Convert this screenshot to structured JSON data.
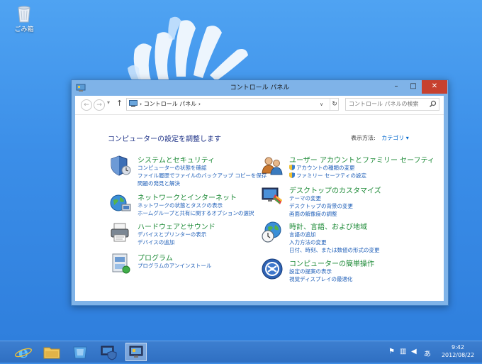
{
  "desktop": {
    "recycle_bin_label": "ごみ箱"
  },
  "window": {
    "title": "コントロール パネル",
    "buttons": {
      "minimize": "–",
      "maximize": "□",
      "close": "✕"
    },
    "nav": {
      "back": "←",
      "forward": "→",
      "recent": "▾",
      "up": "↑"
    },
    "address": {
      "path": "›  コントロール パネル  ›",
      "dropdown": "∨",
      "refresh": "↻"
    },
    "search": {
      "placeholder": "コントロール パネルの検索"
    },
    "heading": "コンピューターの設定を調整します",
    "view_by": {
      "label": "表示方法:",
      "value": "カテゴリ ▾"
    },
    "categories": [
      {
        "title": "システムとセキュリティ",
        "icon": "shield-icon",
        "links": [
          "コンピューターの状態を確認",
          "ファイル履歴でファイルのバックアップ コピーを保存",
          "問題の発見と解決"
        ]
      },
      {
        "title": "ネットワークとインターネット",
        "icon": "network-globe-icon",
        "links": [
          "ネットワークの状態とタスクの表示",
          "ホームグループと共有に関するオプションの選択"
        ]
      },
      {
        "title": "ハードウェアとサウンド",
        "icon": "printer-icon",
        "links": [
          "デバイスとプリンターの表示",
          "デバイスの追加"
        ]
      },
      {
        "title": "プログラム",
        "icon": "programs-icon",
        "links": [
          "プログラムのアンインストール"
        ]
      },
      {
        "title": "ユーザー アカウントとファミリー セーフティ",
        "icon": "users-icon",
        "links": [
          "アカウントの種類の変更",
          "ファミリー セーフティの設定"
        ]
      },
      {
        "title": "デスクトップのカスタマイズ",
        "icon": "monitor-paint-icon",
        "links": [
          "テーマの変更",
          "デスクトップの背景の変更",
          "画面の解像度の調整"
        ]
      },
      {
        "title": "時計、言語、および地域",
        "icon": "clock-globe-icon",
        "links": [
          "言語の追加",
          "入力方法の変更",
          "日付、時刻、または数値の形式の変更"
        ]
      },
      {
        "title": "コンピューターの簡単操作",
        "icon": "ease-of-access-icon",
        "links": [
          "設定の提案の表示",
          "視覚ディスプレイの最適化"
        ]
      }
    ]
  },
  "taskbar": {
    "tray_ime": "あ",
    "time": "9:42",
    "date": "2012/08/22"
  },
  "colors": {
    "accent": "#1c8a36",
    "link": "#1f5fb8",
    "heading": "#1e3287",
    "close_button": "#c7412f"
  }
}
